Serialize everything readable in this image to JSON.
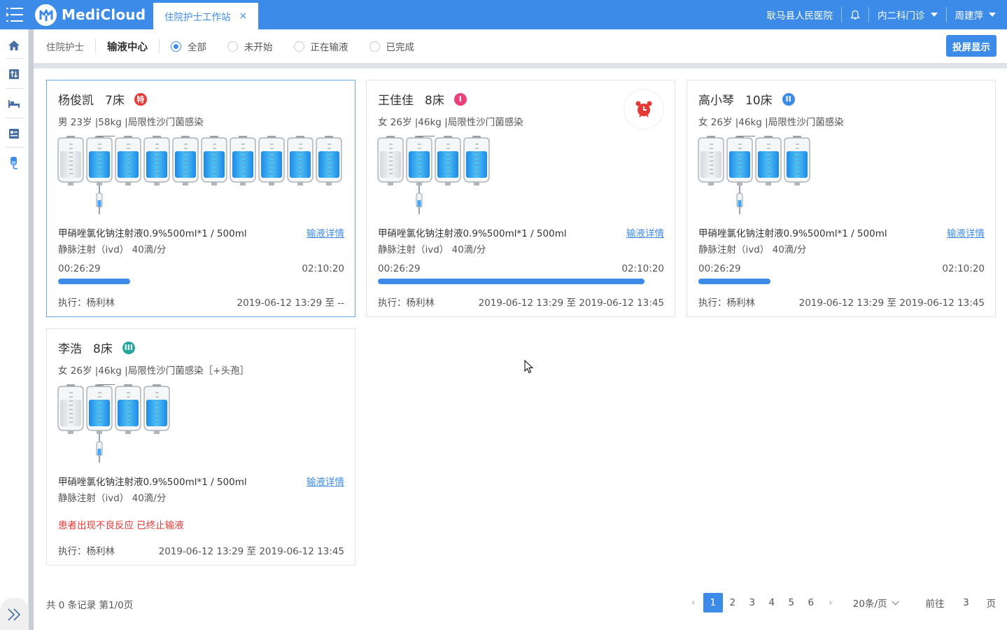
{
  "header": {
    "brand": "MediCloud",
    "tab_label": "住院护士工作站",
    "tab_close": "×",
    "hospital": "耿马县人民医院",
    "department": "内二科门诊",
    "user": "周建萍"
  },
  "toolbar": {
    "crumb": "住院护士",
    "title": "输液中心",
    "filters": [
      {
        "label": "全部",
        "selected": true
      },
      {
        "label": "未开始",
        "selected": false
      },
      {
        "label": "正在输液",
        "selected": false
      },
      {
        "label": "已完成",
        "selected": false
      }
    ],
    "screen_button": "投屏显示"
  },
  "cards": [
    {
      "name": "杨俊凯",
      "bed": "7床",
      "badge": "特",
      "badge_color": "#e53935",
      "info": "男 23岁 |58kg |局限性沙门菌感染",
      "bag_count": 10,
      "drug": "甲硝唑氯化钠注射液0.9%500ml*1 / 500ml",
      "detail_link": "输液详情",
      "route": "静脉注射（ivd） 40滴/分",
      "elapsed": "00:26:29",
      "total": "02:10:20",
      "progress": 0.25,
      "executor": "执行：杨利林",
      "range": "2019-06-12 13:29 至 --",
      "selected": true
    },
    {
      "name": "王佳佳",
      "bed": "8床",
      "badge": "I",
      "badge_color": "#ec407a",
      "info": "女 26岁 |46kg |局限性沙门菌感染",
      "bag_count": 4,
      "drug": "甲硝唑氯化钠注射液0.9%500ml*1 / 500ml",
      "detail_link": "输液详情",
      "route": "静脉注射（ivd） 40滴/分",
      "elapsed": "00:26:29",
      "total": "02:10:20",
      "progress": 0.93,
      "executor": "执行：杨利林",
      "range": "2019-06-12 13:29 至 2019-06-12 13:45",
      "alarm": true
    },
    {
      "name": "高小琴",
      "bed": "10床",
      "badge": "II",
      "badge_color": "#3d8be8",
      "info": "女 26岁 |46kg |局限性沙门菌感染",
      "bag_count": 4,
      "drug": "甲硝唑氯化钠注射液0.9%500ml*1 / 500ml",
      "detail_link": "输液详情",
      "route": "静脉注射（ivd） 40滴/分",
      "elapsed": "00:26:29",
      "total": "02:10:20",
      "progress": 0.25,
      "executor": "执行：杨利林",
      "range": "2019-06-12 13:29 至 2019-06-12 13:45"
    },
    {
      "name": "李浩",
      "bed": "8床",
      "badge": "III",
      "badge_color": "#26a69a",
      "info": "女 26岁 |46kg |局限性沙门菌感染［+头孢］",
      "bag_count": 4,
      "drug": "甲硝唑氯化钠注射液0.9%500ml*1 / 500ml",
      "detail_link": "输液详情",
      "route": "静脉注射（ivd） 40滴/分",
      "warning": "患者出现不良反应 已终止输液",
      "executor": "执行：杨利林",
      "range": "2019-06-12 13:29 至 2019-06-12 13:45"
    }
  ],
  "footer": {
    "total": "共 0 条记录 第1/0页",
    "pages": [
      "1",
      "2",
      "3",
      "4",
      "5",
      "6"
    ],
    "current_page": "1",
    "page_size": "20条/页",
    "goto_label": "前往",
    "goto_value": "3",
    "goto_suffix": "页"
  },
  "colors": {
    "accent": "#3d8be8",
    "warning": "#e53935"
  }
}
